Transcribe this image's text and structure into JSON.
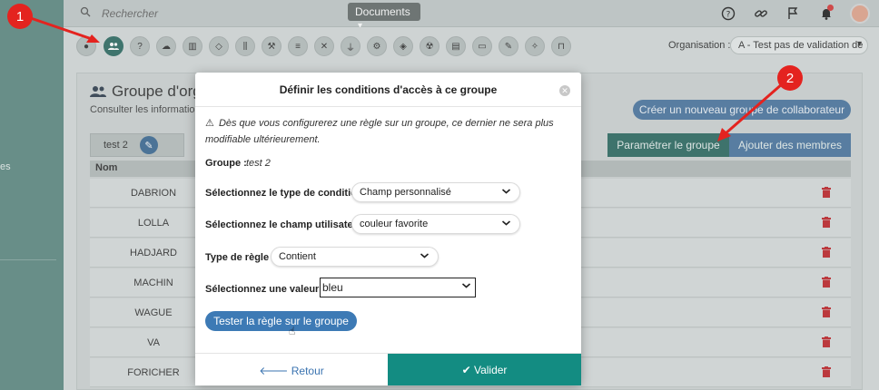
{
  "topbar": {
    "search_placeholder": "Rechercher",
    "documents_label": "Documents"
  },
  "toolbar": {
    "org_label": "Organisation :",
    "org_value": "A - Test pas de validation de"
  },
  "sidebar": {
    "text": "es"
  },
  "panel": {
    "title": "Groupe d'orga",
    "subtitle": "Consulter les informations",
    "create_button": "Créer un nouveau groupe de collaborateur",
    "tab_label": "test 2",
    "param_button": "Paramétrer le groupe",
    "add_button": "Ajouter des membres",
    "col_name": "Nom",
    "rows": [
      "DABRION",
      "LOLLA",
      "HADJARD",
      "MACHIN",
      "WAGUE",
      "VA",
      "FORICHER"
    ]
  },
  "modal": {
    "title": "Définir les conditions d'accès à ce groupe",
    "warning": "Dès que vous configurerez une règle sur un groupe, ce dernier ne sera plus modifiable ultérieurement.",
    "group_label": "Groupe :",
    "group_value": "test 2",
    "condition_label": "Sélectionnez le type de condition :",
    "condition_value": "Champ personnalisé",
    "user_field_label": "Sélectionnez le champ utilisateur :",
    "user_field_value": "couleur favorite",
    "rule_type_label": "Type de règle :",
    "rule_type_value": "Contient",
    "value_label": "Sélectionnez une valeur :",
    "value_value": "bleu",
    "test_button": "Tester la règle sur le groupe",
    "back_button": "Retour",
    "validate_button": "Valider"
  },
  "annotations": [
    "1",
    "2"
  ],
  "colors": {
    "primary": "#138c82",
    "accent_blue": "#3d7ab5",
    "annotation_red": "#e4231f",
    "delete_red": "#c0262b"
  }
}
